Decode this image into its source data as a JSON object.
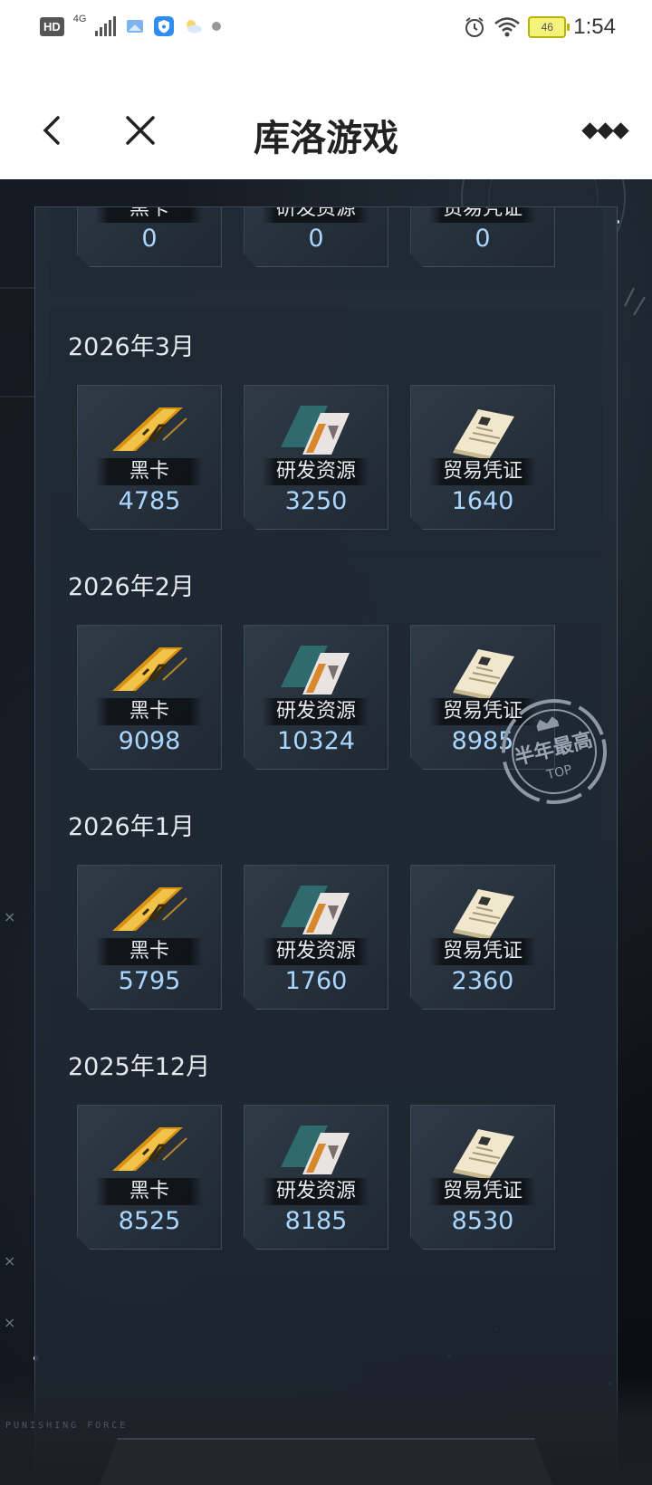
{
  "status_bar": {
    "hd": "HD",
    "net_type": "4G",
    "battery": "46",
    "time": "1:54"
  },
  "header": {
    "title": "库洛游戏"
  },
  "top_partial_row": [
    {
      "label": "黑卡",
      "value": "0"
    },
    {
      "label": "研发资源",
      "value": "0"
    },
    {
      "label": "贸易凭证",
      "value": "0"
    }
  ],
  "months": [
    {
      "title": "2026年3月",
      "items": [
        {
          "label": "黑卡",
          "value": "4785"
        },
        {
          "label": "研发资源",
          "value": "3250"
        },
        {
          "label": "贸易凭证",
          "value": "1640"
        }
      ]
    },
    {
      "title": "2026年2月",
      "items": [
        {
          "label": "黑卡",
          "value": "9098"
        },
        {
          "label": "研发资源",
          "value": "10324"
        },
        {
          "label": "贸易凭证",
          "value": "8985"
        }
      ]
    },
    {
      "title": "2026年1月",
      "items": [
        {
          "label": "黑卡",
          "value": "5795"
        },
        {
          "label": "研发资源",
          "value": "1760"
        },
        {
          "label": "贸易凭证",
          "value": "2360"
        }
      ]
    },
    {
      "title": "2025年12月",
      "items": [
        {
          "label": "黑卡",
          "value": "8525"
        },
        {
          "label": "研发资源",
          "value": "8185"
        },
        {
          "label": "贸易凭证",
          "value": "8530"
        }
      ]
    }
  ],
  "badge": {
    "text": "半年最高",
    "sub": "TOP"
  },
  "footer": {
    "brand": "PUNISHING FORCE"
  },
  "colors": {
    "value_blue": "#a9d6ff",
    "gold": "#e3a320",
    "stamp": "#8c98a6"
  },
  "icons": {
    "black_card": "gold-bar-card-icon",
    "research": "research-resource-card-icon",
    "trade": "trade-voucher-document-icon"
  }
}
